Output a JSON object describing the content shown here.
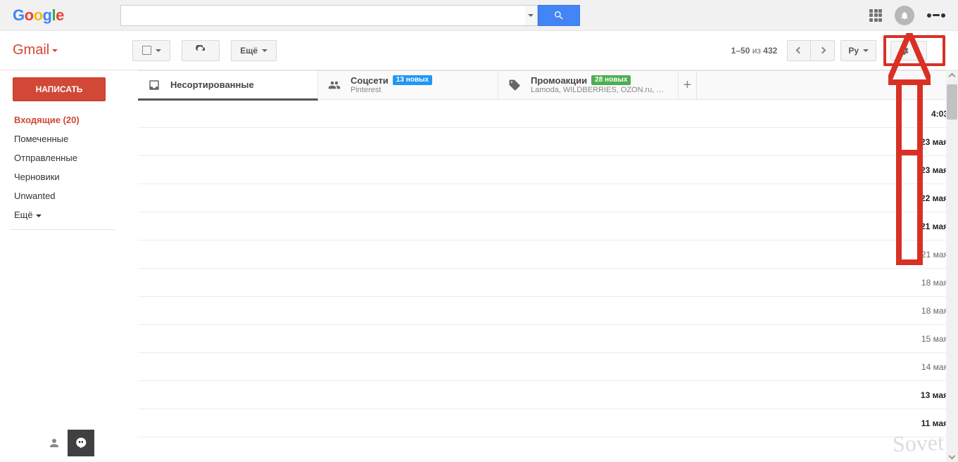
{
  "header": {
    "logo_text": "Google",
    "search_value": "",
    "apps_tooltip": "Apps"
  },
  "toolbar": {
    "brand": "Gmail",
    "more_label": "Ещё",
    "pagination_range": "1–50",
    "pagination_of": "из",
    "pagination_total": "432",
    "lang_label": "Ру"
  },
  "sidebar": {
    "compose_label": "НАПИСАТЬ",
    "items": [
      {
        "label": "Входящие (20)",
        "active": true
      },
      {
        "label": "Помеченные"
      },
      {
        "label": "Отправленные"
      },
      {
        "label": "Черновики"
      },
      {
        "label": "Unwanted"
      }
    ],
    "more_label": "Ещё"
  },
  "categories": {
    "primary": {
      "label": "Несортированные"
    },
    "social": {
      "label": "Соцсети",
      "badge": "13 новых",
      "sub": "Pinterest"
    },
    "promos": {
      "label": "Промоакции",
      "badge": "28 новых",
      "sub": "Lamoda, WILDBERRIES, OZON.ru, La..."
    }
  },
  "mail_rows": [
    {
      "date": "4:03",
      "bold": true
    },
    {
      "date": "23 мая",
      "bold": true
    },
    {
      "date": "23 мая",
      "bold": true
    },
    {
      "date": "22 мая",
      "bold": true
    },
    {
      "date": "21 мая",
      "bold": true
    },
    {
      "date": "21 мая"
    },
    {
      "date": "18 мая"
    },
    {
      "date": "18 мая"
    },
    {
      "date": "15 мая"
    },
    {
      "date": "14 мая"
    },
    {
      "date": "13 мая",
      "bold": true
    },
    {
      "date": "11 мая",
      "bold": true
    }
  ],
  "watermark": "Sovet"
}
